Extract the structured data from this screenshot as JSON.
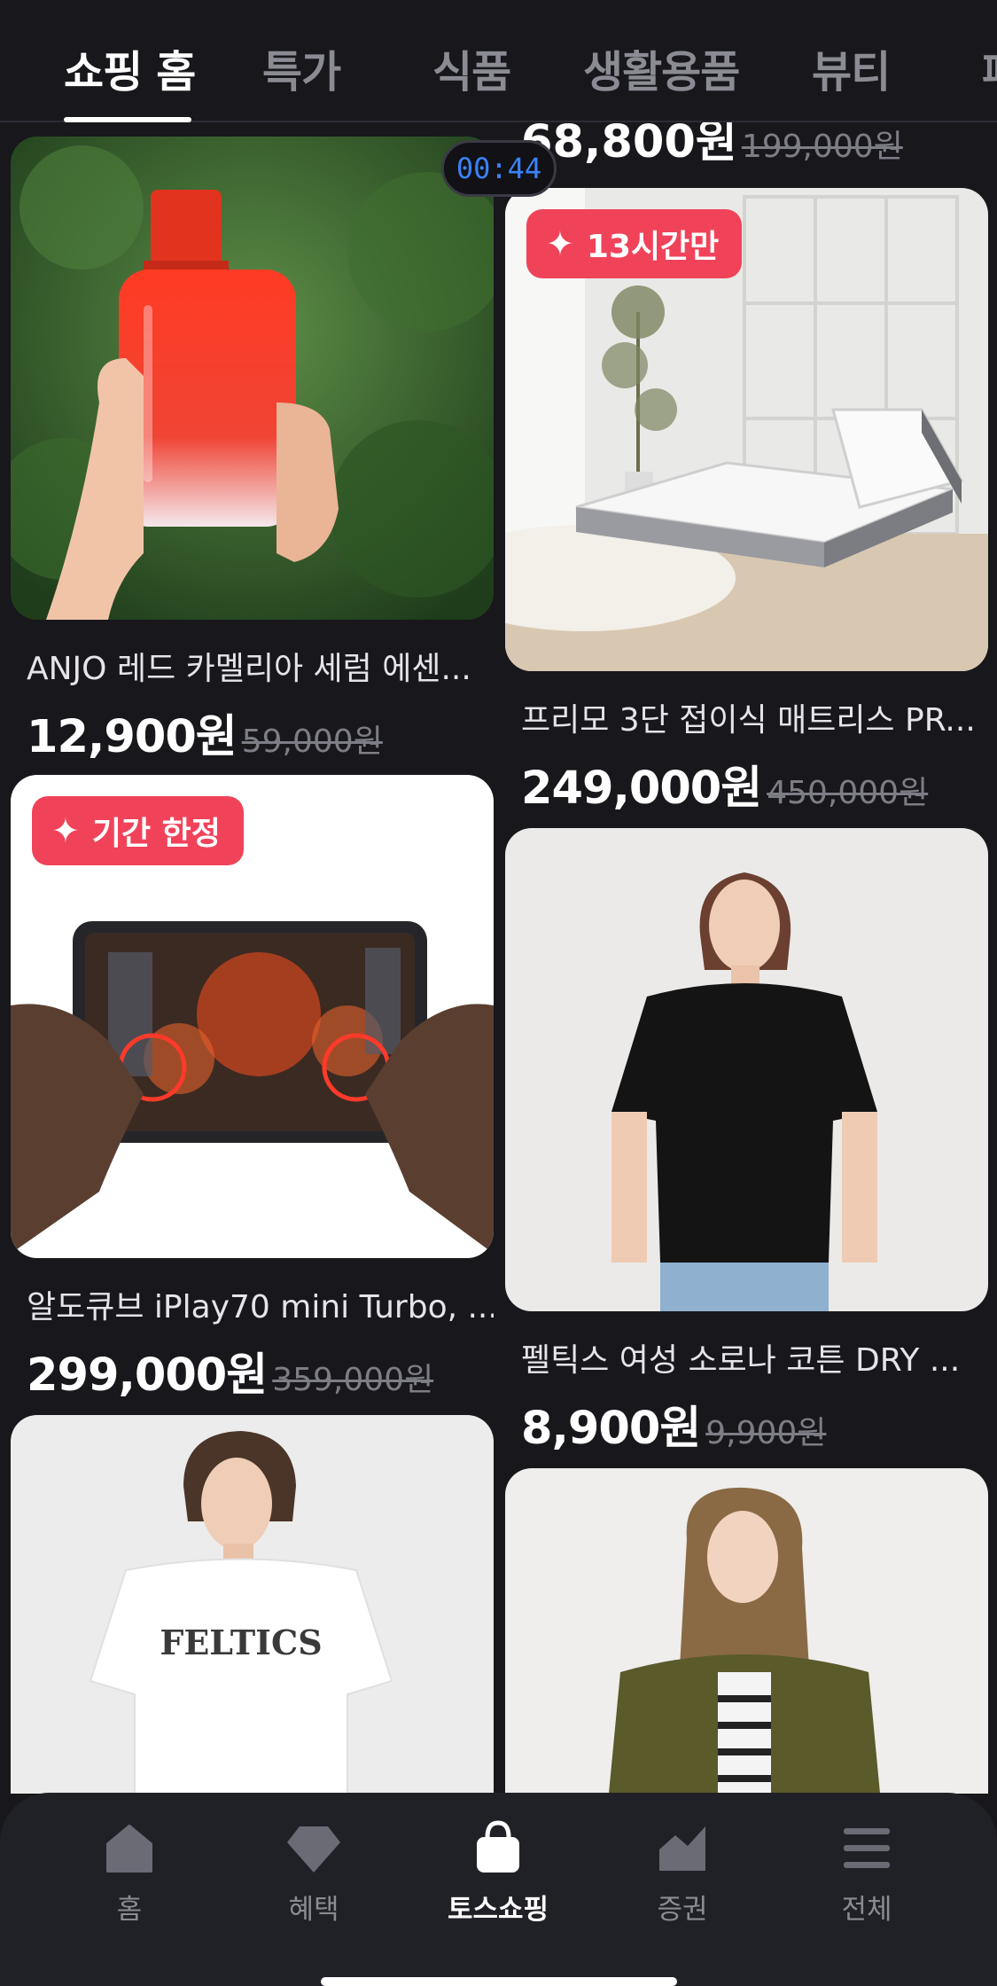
{
  "tabs": [
    {
      "label": "쇼핑 홈",
      "active": true
    },
    {
      "label": "특가"
    },
    {
      "label": "식품"
    },
    {
      "label": "생활용품"
    },
    {
      "label": "뷰티"
    },
    {
      "label": "패"
    }
  ],
  "timer": "00:44",
  "peek_item": {
    "price": "68,800원",
    "original_price": "199,000원"
  },
  "products": [
    {
      "title": "ANJO 레드 카멜리아 세럼 에센...",
      "price": "12,900원",
      "original_price": "59,000원",
      "image": "serum-bottle"
    },
    {
      "title": "프리모 3단 접이식 매트리스 PR...",
      "price": "249,000원",
      "original_price": "450,000원",
      "badge": "13시간만",
      "image": "mattress"
    },
    {
      "title": "알도큐브 iPlay70 mini Turbo, ...",
      "price": "299,000원",
      "original_price": "359,000원",
      "badge": "기간 한정",
      "image": "tablet"
    },
    {
      "title": "펠틱스 여성 소로나 코튼 DRY ...",
      "price": "8,900원",
      "original_price": "9,900원",
      "image": "black-tshirt"
    },
    {
      "title": "",
      "price": "",
      "original_price": "",
      "image": "white-tshirt",
      "print_text": "FELTICS"
    },
    {
      "title": "",
      "price": "",
      "original_price": "",
      "image": "khaki-jacket"
    }
  ],
  "bottom_nav": [
    {
      "label": "홈",
      "icon": "home-icon"
    },
    {
      "label": "혜택",
      "icon": "diamond-icon"
    },
    {
      "label": "토스쇼핑",
      "icon": "shopping-bag-icon",
      "active": true
    },
    {
      "label": "증권",
      "icon": "chart-icon"
    },
    {
      "label": "전체",
      "icon": "menu-icon"
    }
  ],
  "colors": {
    "background": "#17171c",
    "badge": "#f0435a",
    "timer_text": "#3b82f6",
    "nav_bg": "#202027"
  }
}
